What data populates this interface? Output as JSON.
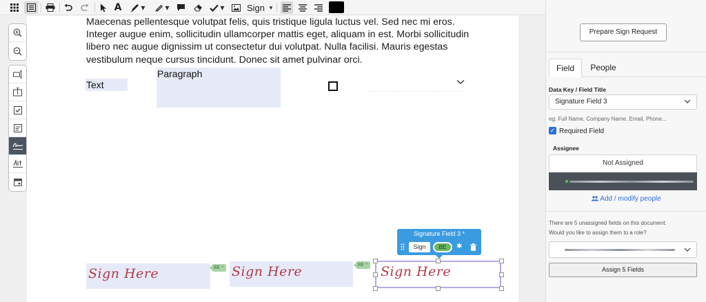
{
  "toolbar": {
    "sign_label": "Sign",
    "tools": [
      "apps-icon",
      "sidebar-icon",
      "print-icon",
      "undo-icon",
      "redo-icon",
      "pointer-icon",
      "text-icon",
      "pen-icon",
      "highlighter-icon",
      "comment-icon",
      "eraser-icon",
      "checkmark-icon",
      "image-icon",
      "sign-icon",
      "align-left-icon",
      "align-center-icon",
      "align-right-icon"
    ],
    "current_color": "#000000"
  },
  "left_tools": {
    "zoom": [
      "zoom-in-icon",
      "zoom-out-icon"
    ],
    "fields": [
      "text-field-icon",
      "text-box-icon",
      "checkbox-icon",
      "dropdown-icon",
      "signature-icon",
      "initials-icon",
      "date-icon"
    ],
    "active": "signature-icon"
  },
  "document": {
    "paragraph": [
      "Maecenas pellentesque volutpat felis, quis tristique ligula luctus vel. Sed nec mi eros.",
      "Integer augue enim, sollicitudin ullamcorper mattis eget, aliquam in est. Morbi sollicitudin",
      "libero nec augue dignissim ut consectetur dui volutpat. Nulla facilisi. Mauris egestas",
      "vestibulum neque cursus tincidunt. Donec sit amet pulvinar orci."
    ],
    "text_field_label": "Text",
    "paragraph_field_label": "Paragraph",
    "sign_fields": [
      {
        "placeholder": "Sign Here",
        "tag": "BE *"
      },
      {
        "placeholder": "Sign Here",
        "tag": "BE *"
      },
      {
        "placeholder": "Sign Here"
      }
    ],
    "popover": {
      "title": "Signature Field 3 *",
      "type_label": "Sign",
      "assignee_badge": "BE"
    }
  },
  "panel": {
    "prepare_button": "Prepare Sign Request",
    "tabs": [
      "Field",
      "People"
    ],
    "active_tab": "Field",
    "data_key_label": "Data Key / Field Title",
    "data_key_value": "Signature Field 3",
    "data_key_hint": "eg: Full Name, Company Name, Email, Phone...",
    "required_label": "Required Field",
    "required_checked": true,
    "assignee_label": "Assignee",
    "assignee_value": "Not Assigned",
    "add_people_link": "Add / modify people",
    "unassigned_note_1": "There are 5 unassigned fields on this document.",
    "unassigned_note_2": "Would you like to assign them to a role?",
    "assign_button": "Assign 5 Fields"
  },
  "colors": {
    "field_fill": "#e6eaf8",
    "signature_ink": "#b23a48",
    "popover_blue": "#3b9be0",
    "assignee_tag_green": "#a9d4a6",
    "selection_outline": "#b5a9ea",
    "link_blue": "#2e6bd8"
  }
}
